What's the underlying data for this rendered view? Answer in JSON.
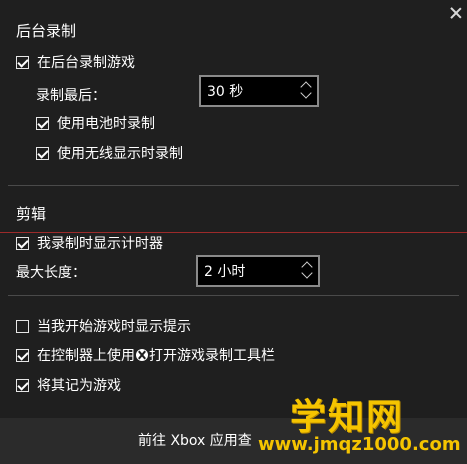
{
  "background_section": {
    "title": "后台录制",
    "record_in_background": {
      "label": "在后台录制游戏",
      "checked": true
    },
    "record_last_label": "录制最后：",
    "record_last_value": "30 秒",
    "record_on_battery": {
      "label": "使用电池时录制",
      "checked": true
    },
    "record_on_wireless": {
      "label": "使用无线显示时录制",
      "checked": true
    }
  },
  "clip_section": {
    "title": "剪辑",
    "show_timer": {
      "label": "我录制时显示计时器",
      "checked": true
    },
    "max_length_label": "最大长度：",
    "max_length_value": "2 小时"
  },
  "tips_section": {
    "show_tips": {
      "label": "当我开始游戏时显示提示",
      "checked": false
    },
    "controller_open_before": "在控制器上使用",
    "controller_open_after": "打开游戏录制工具栏",
    "controller_checked": true,
    "remember_as_game": {
      "label": "将其记为游戏",
      "checked": true
    }
  },
  "bottom_button": "前往 Xbox 应用查",
  "watermark": {
    "brand": "学知网",
    "url": "www.jmqz1000.com"
  },
  "colors": {
    "background": "#1f1f1f",
    "accent_watermark": "#f5c400",
    "red_line": "#9c2a2a"
  },
  "icons": [
    "close-icon",
    "xbox-icon",
    "chevron-up-icon",
    "chevron-down-icon",
    "checkbox-icon"
  ]
}
